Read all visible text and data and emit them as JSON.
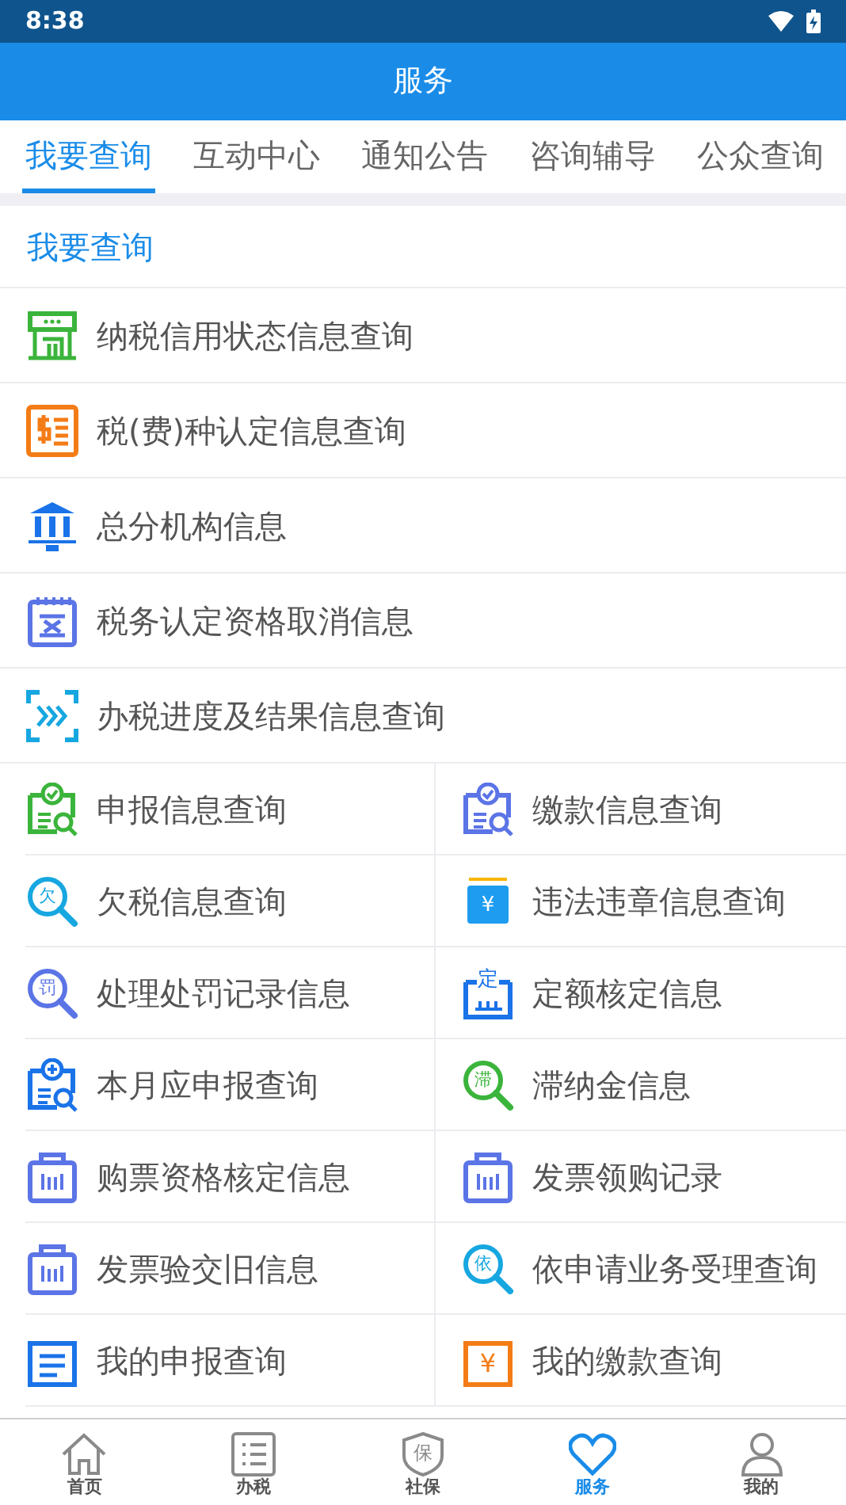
{
  "status_bar": {
    "time": "8:38"
  },
  "header": {
    "title": "服务"
  },
  "tabs": [
    {
      "label": "我要查询",
      "selected": true
    },
    {
      "label": "互动中心",
      "selected": false
    },
    {
      "label": "通知公告",
      "selected": false
    },
    {
      "label": "咨询辅导",
      "selected": false
    },
    {
      "label": "公众查询",
      "selected": false
    }
  ],
  "section": {
    "title": "我要查询"
  },
  "list_items": [
    {
      "label": "纳税信用状态信息查询"
    },
    {
      "label": "税(费)种认定信息查询"
    },
    {
      "label": "总分机构信息"
    },
    {
      "label": "税务认定资格取消信息"
    },
    {
      "label": "办税进度及结果信息查询"
    }
  ],
  "grid_items": [
    {
      "label": "申报信息查询"
    },
    {
      "label": "缴款信息查询"
    },
    {
      "label": "欠税信息查询",
      "icon_text": "欠"
    },
    {
      "label": "违法违章信息查询",
      "icon_text": "¥"
    },
    {
      "label": "处理处罚记录信息",
      "icon_text": "罚"
    },
    {
      "label": "定额核定信息",
      "icon_text": "定"
    },
    {
      "label": "本月应申报查询"
    },
    {
      "label": "滞纳金信息",
      "icon_text": "滞"
    },
    {
      "label": "购票资格核定信息"
    },
    {
      "label": "发票领购记录"
    },
    {
      "label": "发票验交旧信息"
    },
    {
      "label": "依申请业务受理查询",
      "icon_text": "依"
    },
    {
      "label": "我的申报查询"
    },
    {
      "label": "我的缴款查询",
      "icon_text": "¥"
    }
  ],
  "bottom_nav": [
    {
      "label": "首页",
      "selected": false
    },
    {
      "label": "办税",
      "selected": false
    },
    {
      "label": "社保",
      "selected": false,
      "icon_text": "保"
    },
    {
      "label": "服务",
      "selected": true
    },
    {
      "label": "我的",
      "selected": false
    }
  ]
}
